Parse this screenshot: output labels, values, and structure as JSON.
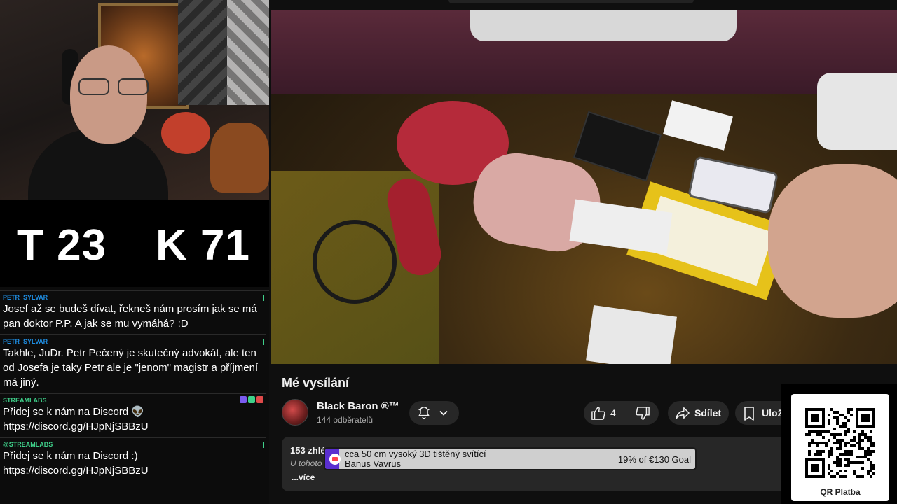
{
  "score": {
    "t_label": "T 23",
    "k_label": "K 71"
  },
  "chat": {
    "messages": [
      {
        "user": "PETR_SYLVAR",
        "text": "Josef až se budeš dívat, řekneš nám prosím jak se má pan doktor P.P. A jak se mu vymáhá? :D"
      },
      {
        "user": "PETR_SYLVAR",
        "text": "Takhle, JuDr. Petr Pečený je skutečný advokát, ale ten od Josefa je taky Petr ale je \"jenom\" magistr a příjmení má jiný."
      },
      {
        "user": "STREAMLABS",
        "text": "Přidej se k nám na Discord 👽 https://discord.gg/HJpNjSBBzU"
      },
      {
        "user": "@STREAMLABS",
        "text": "Přidej se k nám na Discord :) https://discord.gg/HJpNjSBBzU"
      }
    ]
  },
  "video": {
    "title": "Mé vysílání",
    "channel": "Black Baron ®™",
    "subscribers": "144 odběratelů",
    "likes": "4",
    "share_label": "Sdílet",
    "save_label": "Ulož",
    "views": "153 zhlé",
    "description_snippet": "U tohoto",
    "more_label": "...více"
  },
  "goal": {
    "title": "cca 50 cm vysoký 3D tištěný svítící",
    "donor": "Banus Vavrus",
    "progress_text": "19% of €130 Goal",
    "progress": 0.19,
    "color": "#5a2fd0"
  },
  "qr": {
    "label": "QR Platba"
  },
  "colors": {
    "accent_blue": "#1e8ce0",
    "accent_green": "#3fd08a",
    "button_bg": "#272727"
  }
}
